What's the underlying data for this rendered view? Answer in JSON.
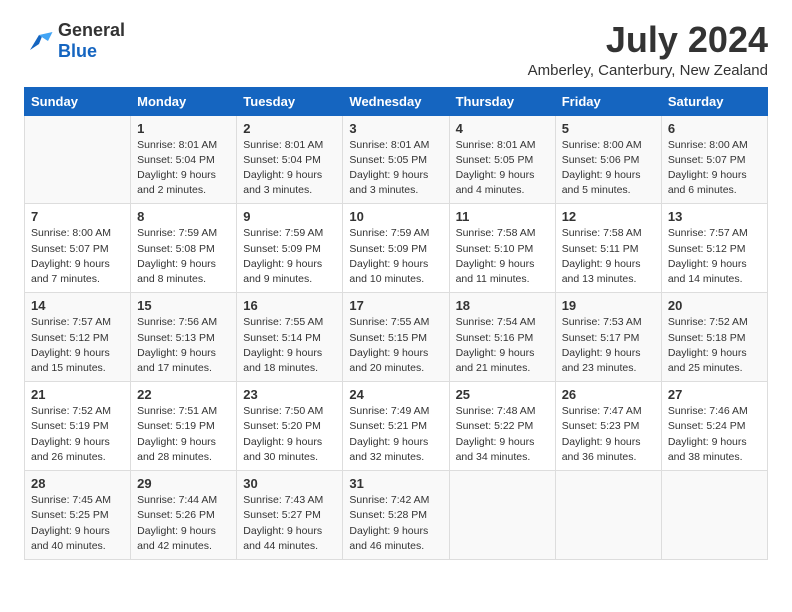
{
  "logo": {
    "text_general": "General",
    "text_blue": "Blue"
  },
  "title": {
    "month_year": "July 2024",
    "location": "Amberley, Canterbury, New Zealand"
  },
  "calendar": {
    "headers": [
      "Sunday",
      "Monday",
      "Tuesday",
      "Wednesday",
      "Thursday",
      "Friday",
      "Saturday"
    ],
    "rows": [
      [
        {
          "day": "",
          "details": ""
        },
        {
          "day": "1",
          "details": "Sunrise: 8:01 AM\nSunset: 5:04 PM\nDaylight: 9 hours\nand 2 minutes."
        },
        {
          "day": "2",
          "details": "Sunrise: 8:01 AM\nSunset: 5:04 PM\nDaylight: 9 hours\nand 3 minutes."
        },
        {
          "day": "3",
          "details": "Sunrise: 8:01 AM\nSunset: 5:05 PM\nDaylight: 9 hours\nand 3 minutes."
        },
        {
          "day": "4",
          "details": "Sunrise: 8:01 AM\nSunset: 5:05 PM\nDaylight: 9 hours\nand 4 minutes."
        },
        {
          "day": "5",
          "details": "Sunrise: 8:00 AM\nSunset: 5:06 PM\nDaylight: 9 hours\nand 5 minutes."
        },
        {
          "day": "6",
          "details": "Sunrise: 8:00 AM\nSunset: 5:07 PM\nDaylight: 9 hours\nand 6 minutes."
        }
      ],
      [
        {
          "day": "7",
          "details": "Sunrise: 8:00 AM\nSunset: 5:07 PM\nDaylight: 9 hours\nand 7 minutes."
        },
        {
          "day": "8",
          "details": "Sunrise: 7:59 AM\nSunset: 5:08 PM\nDaylight: 9 hours\nand 8 minutes."
        },
        {
          "day": "9",
          "details": "Sunrise: 7:59 AM\nSunset: 5:09 PM\nDaylight: 9 hours\nand 9 minutes."
        },
        {
          "day": "10",
          "details": "Sunrise: 7:59 AM\nSunset: 5:09 PM\nDaylight: 9 hours\nand 10 minutes."
        },
        {
          "day": "11",
          "details": "Sunrise: 7:58 AM\nSunset: 5:10 PM\nDaylight: 9 hours\nand 11 minutes."
        },
        {
          "day": "12",
          "details": "Sunrise: 7:58 AM\nSunset: 5:11 PM\nDaylight: 9 hours\nand 13 minutes."
        },
        {
          "day": "13",
          "details": "Sunrise: 7:57 AM\nSunset: 5:12 PM\nDaylight: 9 hours\nand 14 minutes."
        }
      ],
      [
        {
          "day": "14",
          "details": "Sunrise: 7:57 AM\nSunset: 5:12 PM\nDaylight: 9 hours\nand 15 minutes."
        },
        {
          "day": "15",
          "details": "Sunrise: 7:56 AM\nSunset: 5:13 PM\nDaylight: 9 hours\nand 17 minutes."
        },
        {
          "day": "16",
          "details": "Sunrise: 7:55 AM\nSunset: 5:14 PM\nDaylight: 9 hours\nand 18 minutes."
        },
        {
          "day": "17",
          "details": "Sunrise: 7:55 AM\nSunset: 5:15 PM\nDaylight: 9 hours\nand 20 minutes."
        },
        {
          "day": "18",
          "details": "Sunrise: 7:54 AM\nSunset: 5:16 PM\nDaylight: 9 hours\nand 21 minutes."
        },
        {
          "day": "19",
          "details": "Sunrise: 7:53 AM\nSunset: 5:17 PM\nDaylight: 9 hours\nand 23 minutes."
        },
        {
          "day": "20",
          "details": "Sunrise: 7:52 AM\nSunset: 5:18 PM\nDaylight: 9 hours\nand 25 minutes."
        }
      ],
      [
        {
          "day": "21",
          "details": "Sunrise: 7:52 AM\nSunset: 5:19 PM\nDaylight: 9 hours\nand 26 minutes."
        },
        {
          "day": "22",
          "details": "Sunrise: 7:51 AM\nSunset: 5:19 PM\nDaylight: 9 hours\nand 28 minutes."
        },
        {
          "day": "23",
          "details": "Sunrise: 7:50 AM\nSunset: 5:20 PM\nDaylight: 9 hours\nand 30 minutes."
        },
        {
          "day": "24",
          "details": "Sunrise: 7:49 AM\nSunset: 5:21 PM\nDaylight: 9 hours\nand 32 minutes."
        },
        {
          "day": "25",
          "details": "Sunrise: 7:48 AM\nSunset: 5:22 PM\nDaylight: 9 hours\nand 34 minutes."
        },
        {
          "day": "26",
          "details": "Sunrise: 7:47 AM\nSunset: 5:23 PM\nDaylight: 9 hours\nand 36 minutes."
        },
        {
          "day": "27",
          "details": "Sunrise: 7:46 AM\nSunset: 5:24 PM\nDaylight: 9 hours\nand 38 minutes."
        }
      ],
      [
        {
          "day": "28",
          "details": "Sunrise: 7:45 AM\nSunset: 5:25 PM\nDaylight: 9 hours\nand 40 minutes."
        },
        {
          "day": "29",
          "details": "Sunrise: 7:44 AM\nSunset: 5:26 PM\nDaylight: 9 hours\nand 42 minutes."
        },
        {
          "day": "30",
          "details": "Sunrise: 7:43 AM\nSunset: 5:27 PM\nDaylight: 9 hours\nand 44 minutes."
        },
        {
          "day": "31",
          "details": "Sunrise: 7:42 AM\nSunset: 5:28 PM\nDaylight: 9 hours\nand 46 minutes."
        },
        {
          "day": "",
          "details": ""
        },
        {
          "day": "",
          "details": ""
        },
        {
          "day": "",
          "details": ""
        }
      ]
    ]
  }
}
